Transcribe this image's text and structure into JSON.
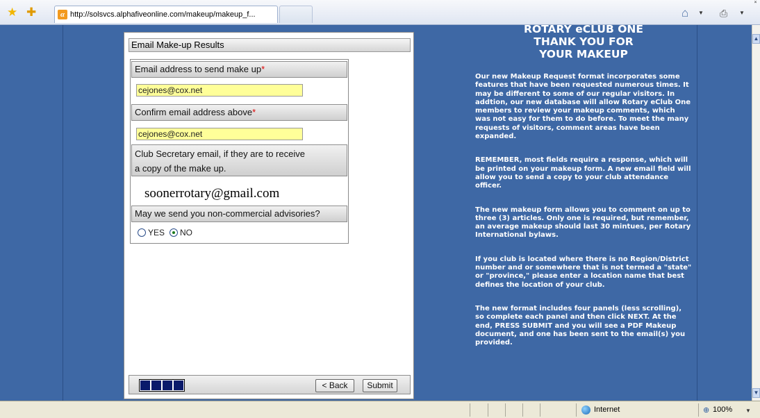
{
  "browser": {
    "tab_url": "http://solsvcs.alphafiveonline.com/makeup/makeup_f...",
    "tab_favicon": "α",
    "close_glyph": "˟"
  },
  "form": {
    "panel_title": "Email Make-up Results",
    "email_label": "Email address to send make up",
    "email_value": "cejones@cox.net",
    "confirm_label": "Confirm email address above",
    "confirm_value": "cejones@cox.net",
    "required_mark": "*",
    "secretary_label_line1": "Club Secretary email, if they are to receive",
    "secretary_label_line2": "a copy of the make up.",
    "secretary_value": "soonerrotary@gmail.com",
    "advisory_label": "May we send you non-commercial advisories?",
    "radio_yes": "YES",
    "radio_no": "NO",
    "radio_selected": "NO",
    "progress_segments": 4,
    "back_label": "< Back",
    "submit_label": "Submit"
  },
  "sidebar": {
    "title_line1": "ROTARY eCLUB ONE",
    "title_line2": "THANK YOU FOR",
    "title_line3": "YOUR MAKEUP",
    "p1": "Our new Makeup Request format incorporates some features that have been requested numerous times. It may be different to some of our regular visitors. In addtion, our new database will allow Rotary eClub One members to review your makeup comments, which was not easy for them to do before. To meet the many requests of visitors, comment areas have been expanded.",
    "p2": "REMEMBER, most fields require a response, which will be printed on your makeup form. A new email field will allow you to send a copy to your club attendance officer.",
    "p3": "The new makeup form allows you to comment on up to three (3) articles. Only one is required, but remember, an average makeup should last 30 mintues, per Rotary International bylaws.",
    "p4": "If you club is located where there is no Region/District number and or somewhere that is not termed a \"state\" or \"province,\" please enter a location name that best defines the location of your club.",
    "p5": "The new format includes four panels (less scrolling), so complete each panel and then click NEXT. At the end, PRESS SUBMIT and you will see a PDF Makeup document, and one has been sent to the email(s) you provided."
  },
  "statusbar": {
    "zone": "Internet",
    "zoom": "100%"
  },
  "icons": {
    "favorites": "star-icon",
    "add_favorites": "add-favorites-icon",
    "home": "home-icon",
    "print": "print-icon",
    "globe": "globe-icon",
    "zoom": "zoom-icon"
  },
  "colors": {
    "page_bg": "#3e68a5",
    "field_bg": "#ffff99",
    "progress": "#0a1a6b",
    "required": "#dd0000"
  }
}
